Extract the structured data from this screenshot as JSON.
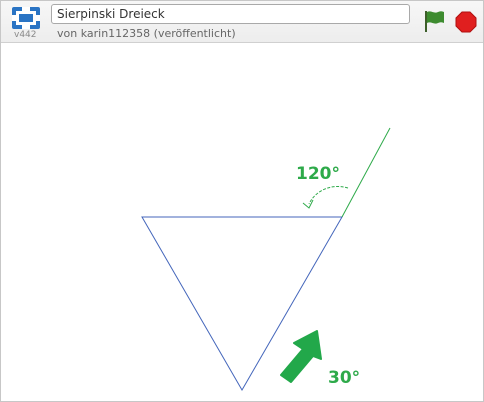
{
  "toolbar": {
    "title": "Sierpinski Dreieck",
    "author": "von karin112358 (veröffentlicht)",
    "version": "v442",
    "fullscreen_icon": "fullscreen-icon",
    "flag_icon": "green-flag-icon",
    "stop_icon": "stop-sign-icon"
  },
  "stage": {
    "angle_top_label": "120°",
    "angle_bottom_label": "30°",
    "triangle_color": "#4466bb",
    "turn_line_color": "#2eaa4a",
    "arrow_color": "#22a84a"
  },
  "colors": {
    "fullscreen": "#2a74c4",
    "flag": "#3d8b2f",
    "stop": "#e01f1f"
  }
}
